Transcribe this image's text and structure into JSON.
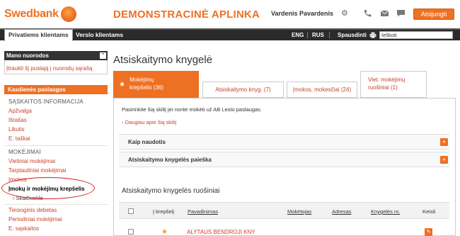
{
  "header": {
    "brand": "Swedbank",
    "demo_title": "DEMONSTRACINĖ APLINKA",
    "user_name": "Vardenis Pavardenis",
    "logout_label": "Atsijungti"
  },
  "navbar": {
    "tabs": [
      {
        "label": "Privatiems klientams"
      },
      {
        "label": "Verslo klientams"
      }
    ],
    "lang_eng": "ENG",
    "lang_rus": "RUS",
    "print_label": "Spausdinti",
    "search_value": "Ieškoti"
  },
  "sidebar": {
    "shortcuts_title": "Mano nuorodos",
    "shortcuts_link": "Įtraukti šį puslapį į nuorodų sąrašą",
    "daily_title": "Kasdienės paslaugos",
    "accounts_section": "SĄSKAITOS INFORMACIJA",
    "accounts_items": [
      "Apžvalga",
      "Išrašas",
      "Likutis",
      "E. taškai"
    ],
    "payments_section": "MOKĖJIMAI",
    "payments_items": [
      "Vietiniai mokėjimai",
      "Tarptautiniai mokėjimai",
      "Įmokos"
    ],
    "active_item": "Įmokų ir mokėjimų krepšelis",
    "active_sub": "Skaičiuoklė",
    "more_items": [
      "Tiesioginis debetas",
      "Periodiniai mokėjimai",
      "E. sąskaitos"
    ]
  },
  "main": {
    "title": "Atsiskaitymo knygelė",
    "tabs": [
      {
        "line1": "Mokėjimų",
        "line2": "krepšelis (36)"
      },
      {
        "label": "Atsiskaitymo knyg. (7)"
      },
      {
        "label": "Įmokos, mokesčiai (24)"
      },
      {
        "line1": "Viet. mokėjimų",
        "line2": "ruošiniai (1)"
      }
    ],
    "intro_text": "Pasirinkite šią skiltį jei norite mokėti už AB Lesto paslaugas.",
    "more_link": "› Daugiau apie šią skiltį",
    "accordion_how": "Kaip naudotis",
    "accordion_search": "Atsiskaitymo knygelės paieška",
    "section_title": "Atsiskaitymo knygelės ruošiniai",
    "table": {
      "headers": {
        "basket": "Į krepšelį",
        "name": "Pavadinimas",
        "payer": "Mokėtojas",
        "address": "Adresas",
        "book_no": "Knygelės nr.",
        "edit": "Keisti"
      },
      "rows": [
        {
          "name": "ALYTAUS BENDROJI KNY"
        }
      ]
    }
  },
  "colors": {
    "accent": "#ee7023",
    "link": "#c8432b",
    "navbar": "#2b2b2b",
    "highlight_ring": "#d21f1f"
  }
}
